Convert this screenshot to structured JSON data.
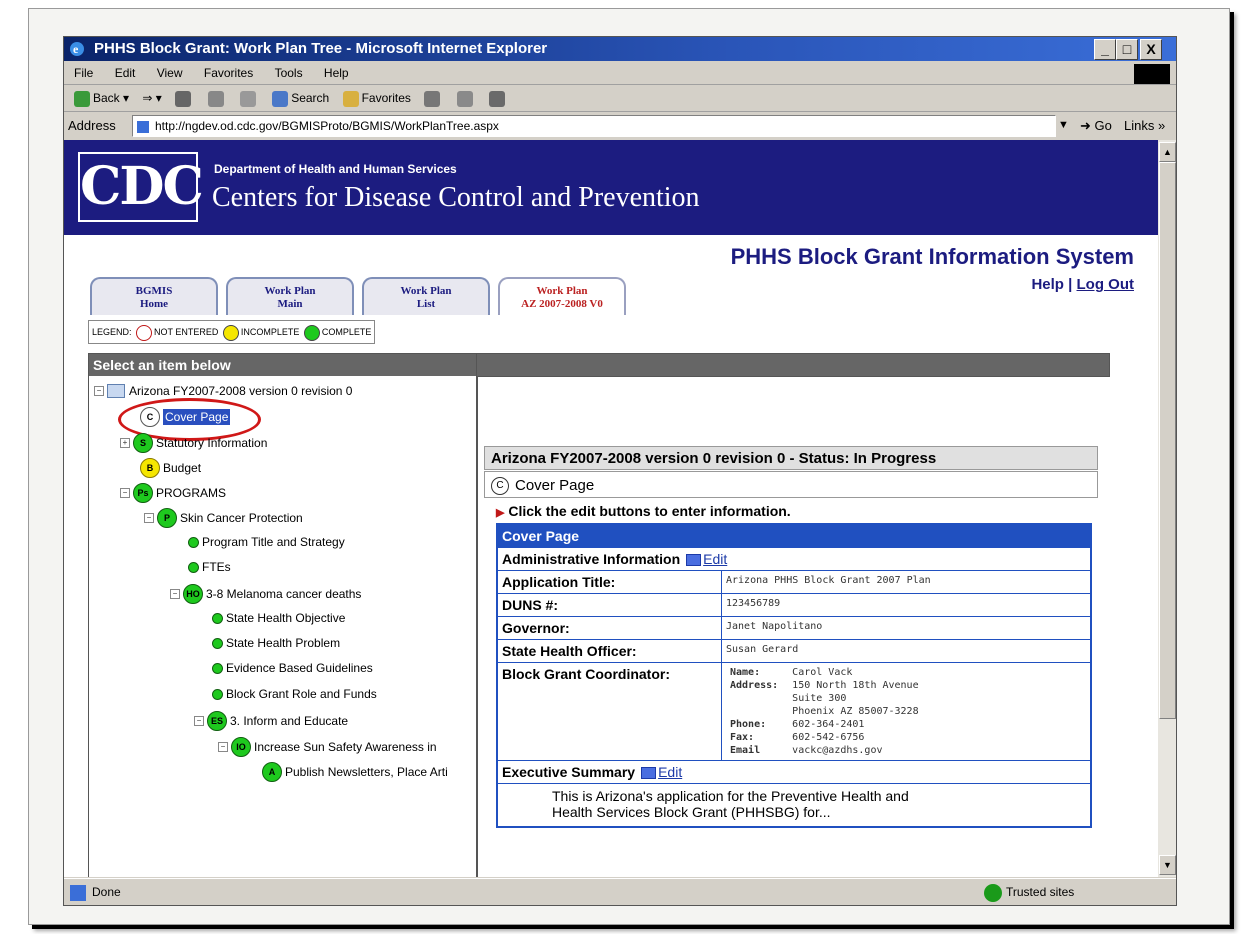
{
  "window": {
    "title": "PHHS Block Grant: Work Plan Tree - Microsoft Internet Explorer",
    "min_label": "_",
    "max_label": "□",
    "close_label": "X"
  },
  "menu": [
    "File",
    "Edit",
    "View",
    "Favorites",
    "Tools",
    "Help"
  ],
  "toolbar": {
    "back": "Back",
    "search": "Search",
    "favorites": "Favorites"
  },
  "address": {
    "label": "Address",
    "url": "http://ngdev.od.cdc.gov/BGMISProto/BGMIS/WorkPlanTree.aspx",
    "go": "Go",
    "links": "Links »"
  },
  "status": {
    "text": "Done",
    "zone": "Trusted sites"
  },
  "banner": {
    "logo": "CDC",
    "dept": "Department of Health and Human Services",
    "org": "Centers for Disease Control and Prevention"
  },
  "header": {
    "system": "PHHS Block Grant Information System",
    "help": "Help",
    "sep": "|",
    "logout": "Log Out"
  },
  "tabs": [
    {
      "l1": "BGMIS",
      "l2": "Home"
    },
    {
      "l1": "Work Plan",
      "l2": "Main"
    },
    {
      "l1": "Work Plan",
      "l2": "List"
    },
    {
      "l1": "Work Plan",
      "l2": "AZ 2007-2008 V0"
    }
  ],
  "legend": {
    "label": "LEGEND:",
    "not_entered": "NOT ENTERED",
    "incomplete": "INCOMPLETE",
    "complete": "COMPLETE"
  },
  "tree": {
    "header": "Select an item below",
    "root": "Arizona FY2007-2008 version 0 revision 0",
    "items": [
      {
        "icon": "C",
        "label": "Cover Page"
      },
      {
        "icon": "S",
        "label": "Statutory Information"
      },
      {
        "icon": "B",
        "label": "Budget"
      },
      {
        "icon": "Ps",
        "label": "PROGRAMS"
      },
      {
        "icon": "P",
        "label": "Skin Cancer Protection"
      },
      {
        "icon": "",
        "label": "Program Title and Strategy"
      },
      {
        "icon": "",
        "label": "FTEs"
      },
      {
        "icon": "HO",
        "label": "3-8 Melanoma cancer deaths"
      },
      {
        "icon": "",
        "label": "State Health Objective"
      },
      {
        "icon": "",
        "label": "State Health Problem"
      },
      {
        "icon": "",
        "label": "Evidence Based Guidelines"
      },
      {
        "icon": "",
        "label": "Block Grant Role and Funds"
      },
      {
        "icon": "ES",
        "label": "3. Inform and Educate"
      },
      {
        "icon": "IO",
        "label": "Increase Sun Safety Awareness in"
      },
      {
        "icon": "A",
        "label": "Publish Newsletters, Place Arti"
      }
    ]
  },
  "detail": {
    "title": "Arizona FY2007-2008 version 0 revision 0 - Status: In Progress",
    "page_icon": "C",
    "page": "Cover Page",
    "instruction": "Click the edit buttons to enter information.",
    "table_header": "Cover Page",
    "admin_label": "Administrative Information",
    "edit": "Edit",
    "fields": [
      {
        "k": "Application Title:",
        "v": "Arizona PHHS Block Grant 2007 Plan"
      },
      {
        "k": "DUNS #:",
        "v": "123456789"
      },
      {
        "k": "Governor:",
        "v": "Janet Napolitano"
      },
      {
        "k": "State Health Officer:",
        "v": "Susan Gerard"
      }
    ],
    "coordinator": {
      "label": "Block Grant Coordinator:",
      "name_l": "Name:",
      "name": "Carol Vack",
      "addr_l": "Address:",
      "addr1": "150 North 18th Avenue",
      "addr2": "Suite 300",
      "addr3": "Phoenix AZ 85007-3228",
      "phone_l": "Phone:",
      "phone": "602-364-2401",
      "fax_l": "Fax:",
      "fax": "602-542-6756",
      "email_l": "Email",
      "email": "vackc@azdhs.gov"
    },
    "exec_label": "Executive Summary",
    "exec_text1": "This is Arizona's application for the Preventive Health and",
    "exec_text2": "Health Services Block Grant (PHHSBG) for..."
  },
  "colors": {
    "banner": "#1c1c80",
    "complete": "#1ec91e",
    "incomplete": "#f5e600",
    "highlight": "#d01818"
  }
}
